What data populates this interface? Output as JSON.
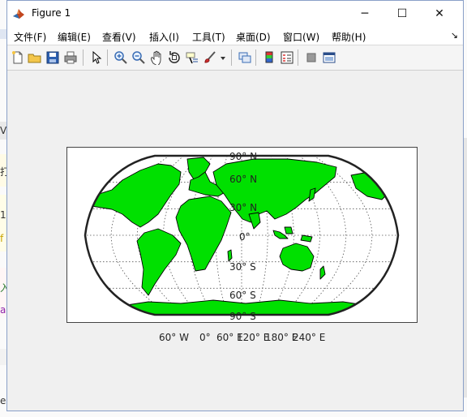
{
  "window": {
    "title": "Figure 1",
    "controls": {
      "minimize": "─",
      "maximize": "☐",
      "close": "✕"
    }
  },
  "menu": [
    {
      "label": "文件(F)"
    },
    {
      "label": "编辑(E)"
    },
    {
      "label": "查看(V)"
    },
    {
      "label": "插入(I)"
    },
    {
      "label": "工具(T)"
    },
    {
      "label": "桌面(D)"
    },
    {
      "label": "窗口(W)"
    },
    {
      "label": "帮助(H)"
    }
  ],
  "menu_overflow": "↘",
  "toolbar": [
    {
      "name": "new-figure-icon"
    },
    {
      "name": "open-file-icon"
    },
    {
      "name": "save-icon"
    },
    {
      "name": "print-icon"
    },
    {
      "name": "pointer-icon"
    },
    {
      "name": "zoom-in-icon"
    },
    {
      "name": "zoom-out-icon"
    },
    {
      "name": "pan-icon"
    },
    {
      "name": "rotate-3d-icon"
    },
    {
      "name": "data-cursor-icon"
    },
    {
      "name": "brush-icon"
    },
    {
      "name": "brush-dropdown-icon"
    },
    {
      "name": "link-plot-icon"
    },
    {
      "name": "colorbar-icon"
    },
    {
      "name": "legend-icon"
    },
    {
      "name": "hide-plot-tools-icon"
    },
    {
      "name": "show-plot-tools-icon"
    }
  ],
  "map": {
    "lat_labels": [
      "90° N",
      "60° N",
      "30° N",
      "0°",
      "30° S",
      "60° S",
      "90° S"
    ],
    "lon_labels": [
      "60° W",
      "0°",
      "60° E",
      "120° E",
      "180° E",
      "240° E"
    ],
    "colors": {
      "land": "#00e000",
      "coast": "#000000",
      "frame": "#222222"
    }
  },
  "background_glyphs": [
    "V",
    "打",
    "1",
    "f",
    "入",
    "a",
    "e"
  ]
}
